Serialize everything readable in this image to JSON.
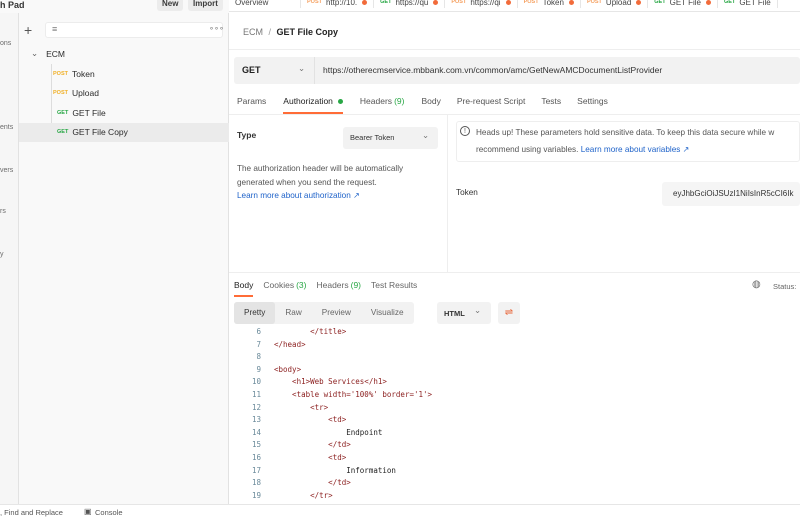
{
  "app": {
    "workspace_title": "h Pad",
    "new_label": "New",
    "import_label": "Import"
  },
  "rail": [
    "ons",
    "ents",
    "vers",
    "rs",
    "y"
  ],
  "sidebar": {
    "collection": "ECM",
    "items": [
      {
        "method": "POST",
        "name": "Token"
      },
      {
        "method": "POST",
        "name": "Upload"
      },
      {
        "method": "GET",
        "name": "GET File"
      },
      {
        "method": "GET",
        "name": "GET File Copy",
        "selected": true
      }
    ]
  },
  "tabs": [
    {
      "method": "",
      "label": "Overview"
    },
    {
      "method": "POST",
      "label": "http://10."
    },
    {
      "method": "GET",
      "label": "https://qu"
    },
    {
      "method": "POST",
      "label": "https://qi"
    },
    {
      "method": "POST",
      "label": "Token"
    },
    {
      "method": "POST",
      "label": "Upload"
    },
    {
      "method": "GET",
      "label": "GET File"
    },
    {
      "method": "GET",
      "label": "GET File"
    }
  ],
  "breadcrumb": {
    "parent": "ECM",
    "sep": "/",
    "current": "GET File Copy"
  },
  "request": {
    "method": "GET",
    "url": "https://otherecmservice.mbbank.com.vn/common/amc/GetNewAMCDocumentListProvider",
    "tabs": [
      {
        "label": "Params"
      },
      {
        "label": "Authorization",
        "active": true
      },
      {
        "label": "Headers",
        "count": "(9)"
      },
      {
        "label": "Body"
      },
      {
        "label": "Pre-request Script"
      },
      {
        "label": "Tests"
      },
      {
        "label": "Settings"
      }
    ]
  },
  "auth": {
    "type_label": "Type",
    "type_value": "Bearer Token",
    "desc": "The authorization header will be automatically generated when you send the request.",
    "learn": "Learn more about authorization ↗",
    "notice": "Heads up! These parameters hold sensitive data. To keep this data secure while w",
    "notice2": "recommend using variables.",
    "notice_link": "Learn more about variables ↗",
    "token_label": "Token",
    "token_value": "eyJhbGciOiJSUzI1NiIsInR5cCI6Ik"
  },
  "response": {
    "tabs": [
      {
        "label": "Body",
        "active": true
      },
      {
        "label": "Cookies",
        "count": "(3)"
      },
      {
        "label": "Headers",
        "count": "(9)"
      },
      {
        "label": "Test Results"
      }
    ],
    "status": "Status:",
    "views": [
      "Pretty",
      "Raw",
      "Preview",
      "Visualize"
    ],
    "format": "HTML"
  },
  "code": [
    {
      "n": "6",
      "t": "        </title>"
    },
    {
      "n": "7",
      "t": "</head>"
    },
    {
      "n": "8",
      "t": ""
    },
    {
      "n": "9",
      "t": "<body>"
    },
    {
      "n": "10",
      "t": "    <h1>Web Services</h1>"
    },
    {
      "n": "11",
      "t": "    <table width='100%' border='1'>"
    },
    {
      "n": "12",
      "t": "        <tr>"
    },
    {
      "n": "13",
      "t": "            <td>"
    },
    {
      "n": "14",
      "t": "                Endpoint"
    },
    {
      "n": "15",
      "t": "            </td>"
    },
    {
      "n": "16",
      "t": "            <td>"
    },
    {
      "n": "17",
      "t": "                Information"
    },
    {
      "n": "18",
      "t": "            </td>"
    },
    {
      "n": "19",
      "t": "        </tr>"
    }
  ],
  "statusbar": {
    "find": ", Find and Replace",
    "console": "Console"
  },
  "colors": {
    "accent": "#ff6c37",
    "post": "#f0b028",
    "get": "#28a745",
    "link": "#1e62c9"
  }
}
